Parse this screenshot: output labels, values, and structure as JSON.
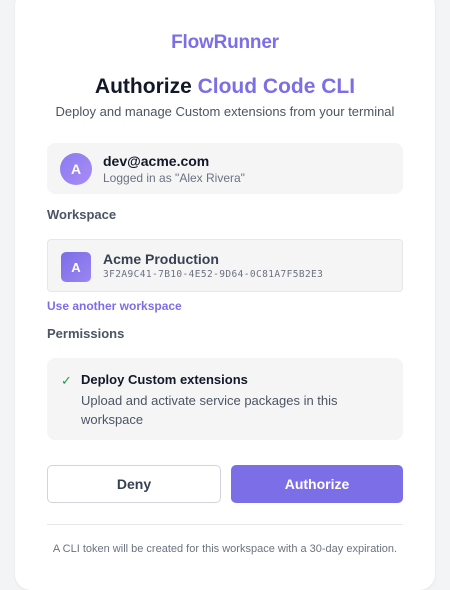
{
  "brand": "FlowRunner",
  "title": {
    "prefix": "Authorize",
    "app_name": "Cloud Code CLI"
  },
  "subtitle": "Deploy and manage Custom extensions from your terminal",
  "user": {
    "avatar_initial": "A",
    "email": "dev@acme.com",
    "logged_in_as": "Logged in as \"Alex Rivera\""
  },
  "workspace": {
    "label": "Workspace",
    "avatar_initial": "A",
    "name": "Acme Production",
    "id": "3F2A9C41-7B10-4E52-9D64-0C81A7F5B2E3",
    "change_link": "Use another workspace"
  },
  "permissions": {
    "label": "Permissions",
    "items": [
      {
        "title": "Deploy Custom extensions",
        "description": "Upload and activate service packages in this workspace"
      }
    ]
  },
  "buttons": {
    "deny": "Deny",
    "authorize": "Authorize"
  },
  "footnote": "A CLI token will be created for this workspace with a 30-day expiration.",
  "colors": {
    "accent": "#7c6ee6",
    "check": "#16a34a"
  }
}
